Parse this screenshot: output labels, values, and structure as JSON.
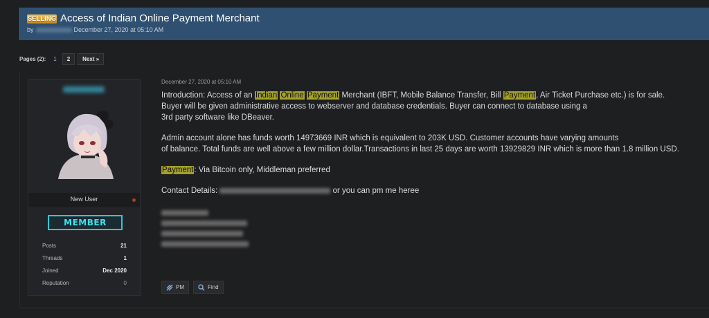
{
  "thread": {
    "prefix": "SELLING",
    "title": "Access of Indian Online Payment Merchant",
    "by": "by",
    "date": "December 27, 2020 at 05:10 AM"
  },
  "pagination": {
    "label": "Pages (2):",
    "pages": [
      "1",
      "2"
    ],
    "next": "Next »"
  },
  "user": {
    "title": "New User",
    "badge": "MEMBER",
    "stats": [
      {
        "label": "Posts",
        "value": "21"
      },
      {
        "label": "Threads",
        "value": "1"
      },
      {
        "label": "Joined",
        "value": "Dec 2020"
      },
      {
        "label": "Reputation",
        "value": "0"
      }
    ]
  },
  "post": {
    "date": "December 27, 2020 at 05:10 AM",
    "intro_prefix": "Introduction: Access of an ",
    "hl_indian": "Indian",
    "hl_online": "Online",
    "hl_payment": "Payment",
    "intro_mid": " Merchant (IBFT, Mobile Balance Transfer, Bill ",
    "hl_payment2": "Payment",
    "intro_end": ", Air Ticket Purchase etc.) is for sale.",
    "line2": "Buyer will be given administrative access to webserver and database credentials. Buyer can connect to database using a",
    "line3": "3rd party software like DBeaver.",
    "line4": "Admin account alone has funds worth 14973669 INR which is equivalent to 203K USD. Customer accounts have varying amounts",
    "line5": "of balance. Total funds are well above a few million dollar.Transactions in last 25 days are worth 13929829 INR which is more than 1.8 million USD.",
    "hl_payment3": "Payment",
    "payment_rest": ": Via Bitcoin only, Middleman preferred",
    "contact_prefix": "Contact Details:",
    "contact_suffix": "or you can pm me heree"
  },
  "buttons": {
    "pm": "PM",
    "find": "Find"
  }
}
